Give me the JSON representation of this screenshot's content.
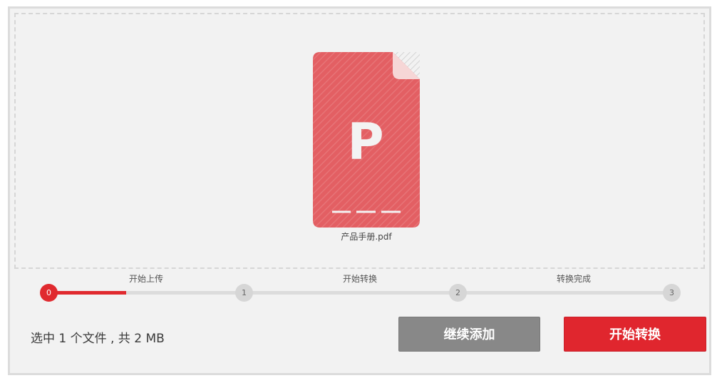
{
  "file": {
    "name": "产品手册.pdf",
    "type_letter": "P",
    "icon_color": "#e35f63"
  },
  "progress": {
    "fill_fraction": 0.125,
    "accent_color": "#e02a2f",
    "nodes": [
      "0",
      "1",
      "2",
      "3"
    ],
    "steps": [
      "开始上传",
      "开始转换",
      "转换完成"
    ]
  },
  "summary": "选中 1 个文件 , 共 2 MB",
  "buttons": {
    "add_label": "继续添加",
    "start_label": "开始转换"
  }
}
